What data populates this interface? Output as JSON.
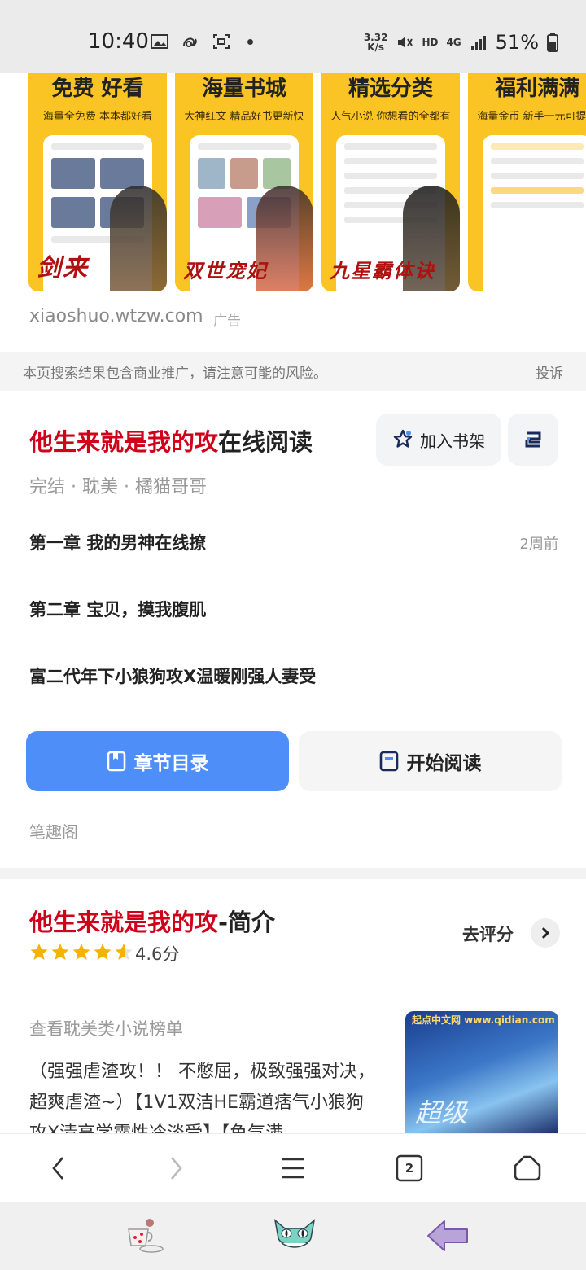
{
  "status_bar": {
    "time": "10:40",
    "net_speed_value": "3.32",
    "net_speed_unit": "K/s",
    "hd": "HD",
    "network": "4G",
    "battery": "51%"
  },
  "ad": {
    "cards": [
      {
        "headline": "免费 好看",
        "subtitle": "海量全免费 本本都好看",
        "calligraphy": "剑来"
      },
      {
        "headline": "海量书城",
        "subtitle": "大神红文 精品好书更新快",
        "calligraphy": "双世宠妃"
      },
      {
        "headline": "精选分类",
        "subtitle": "人气小说 你想看的全都有",
        "calligraphy": "九星霸体诀"
      },
      {
        "headline": "福利满满",
        "subtitle": "海量金币 新手一元可提现",
        "calligraphy": ""
      }
    ],
    "source": "xiaoshuo.wtzw.com",
    "tag": "广告"
  },
  "notice": {
    "text": "本页搜索结果包含商业推广，请注意可能的风险。",
    "report": "投诉"
  },
  "result1": {
    "title_highlight": "他生来就是我的攻",
    "title_rest": "在线阅读",
    "add_shelf": "加入书架",
    "meta": "完结 · 耽美 · 橘猫哥哥",
    "chapters": [
      {
        "name": "第一章 我的男神在线撩",
        "time": "2周前"
      },
      {
        "name": "第二章 宝贝，摸我腹肌"
      },
      {
        "name": "富二代年下小狼狗攻X温暖刚强人妻受"
      }
    ],
    "toc_button": "章节目录",
    "read_button": "开始阅读",
    "source": "笔趣阁"
  },
  "result2": {
    "title_highlight": "他生来就是我的攻",
    "title_rest": "-简介",
    "rating": 4.6,
    "score": "4.6分",
    "rate_button": "去评分",
    "rank_link": "查看耽美类小说榜单",
    "description": "（强强虐渣攻！！ 不憋屈，极致强强对决，超爽虐渣~）【1V1双洁HE霸道痞气小狼狗攻X清高学霸性冷淡受】【鱼气满",
    "cover_site": "起点中文网 www.qidian.com",
    "cover_text": "超级"
  },
  "nav": {
    "tab_count": "2"
  }
}
